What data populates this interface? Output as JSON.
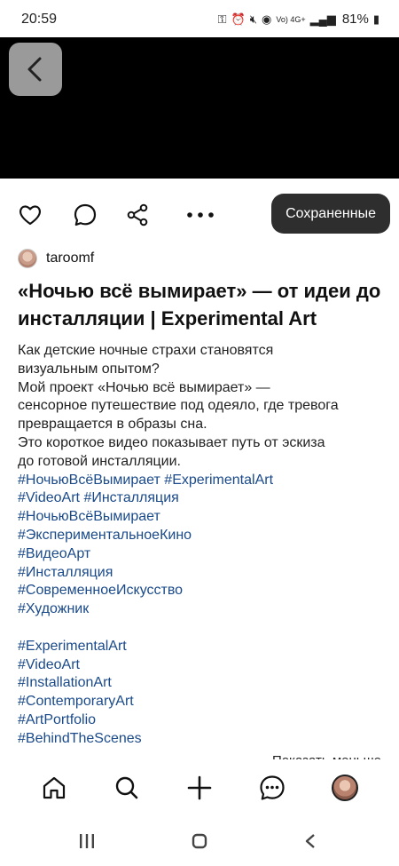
{
  "status_bar": {
    "time": "20:59",
    "signal_text": "Vo) 4G+",
    "battery": "81%"
  },
  "post": {
    "saved_label": "Сохраненные",
    "author": "taroomf",
    "title": "«Ночью всё вымирает» — от идеи до инсталляции | Experimental Art",
    "lines": [
      {
        "text": "Как детские ночные страхи становятся",
        "tag": false
      },
      {
        "text": "визуальным опытом?",
        "tag": false
      },
      {
        "text": "Мой проект «Ночью всё вымирает» —",
        "tag": false
      },
      {
        "text": "сенсорное путешествие под одеяло, где тревога",
        "tag": false
      },
      {
        "text": "превращается в образы сна.",
        "tag": false
      },
      {
        "text": "Это короткое видео показывает путь от эскиза",
        "tag": false
      },
      {
        "text": "до готовой инсталляции.",
        "tag": false
      },
      {
        "text": "#НочьюВсёВымирает #ExperimentalArt",
        "tag": true
      },
      {
        "text": "#VideoArt #Инсталляция",
        "tag": true
      },
      {
        "text": "#НочьюВсёВымирает",
        "tag": true
      },
      {
        "text": "#ЭкспериментальноеКино",
        "tag": true
      },
      {
        "text": "#ВидеоАрт",
        "tag": true
      },
      {
        "text": "#Инсталляция",
        "tag": true
      },
      {
        "text": "#СовременноеИскусство",
        "tag": true
      },
      {
        "text": "#Художник",
        "tag": true
      },
      {
        "text": "",
        "tag": false
      },
      {
        "text": "#ExperimentalArt",
        "tag": true
      },
      {
        "text": "#VideoArt",
        "tag": true
      },
      {
        "text": "#InstallationArt",
        "tag": true
      },
      {
        "text": "#ContemporaryArt",
        "tag": true
      },
      {
        "text": "#ArtPortfolio",
        "tag": true
      },
      {
        "text": "#BehindTheScenes",
        "tag": true
      }
    ],
    "show_less": "Показать меньше"
  },
  "icons": {
    "back": "chevron-left-icon",
    "like": "heart-icon",
    "comment": "comment-bubble-icon",
    "share": "share-icon",
    "more": "more-dots-icon",
    "nav_home": "home-icon",
    "nav_search": "search-icon",
    "nav_create": "plus-icon",
    "nav_messages": "chat-bubble-icon",
    "nav_profile": "profile-avatar"
  },
  "colors": {
    "video_bg": "#000000",
    "saved_button_bg": "#2e2e2e",
    "hashtag": "#1a4a8a"
  }
}
